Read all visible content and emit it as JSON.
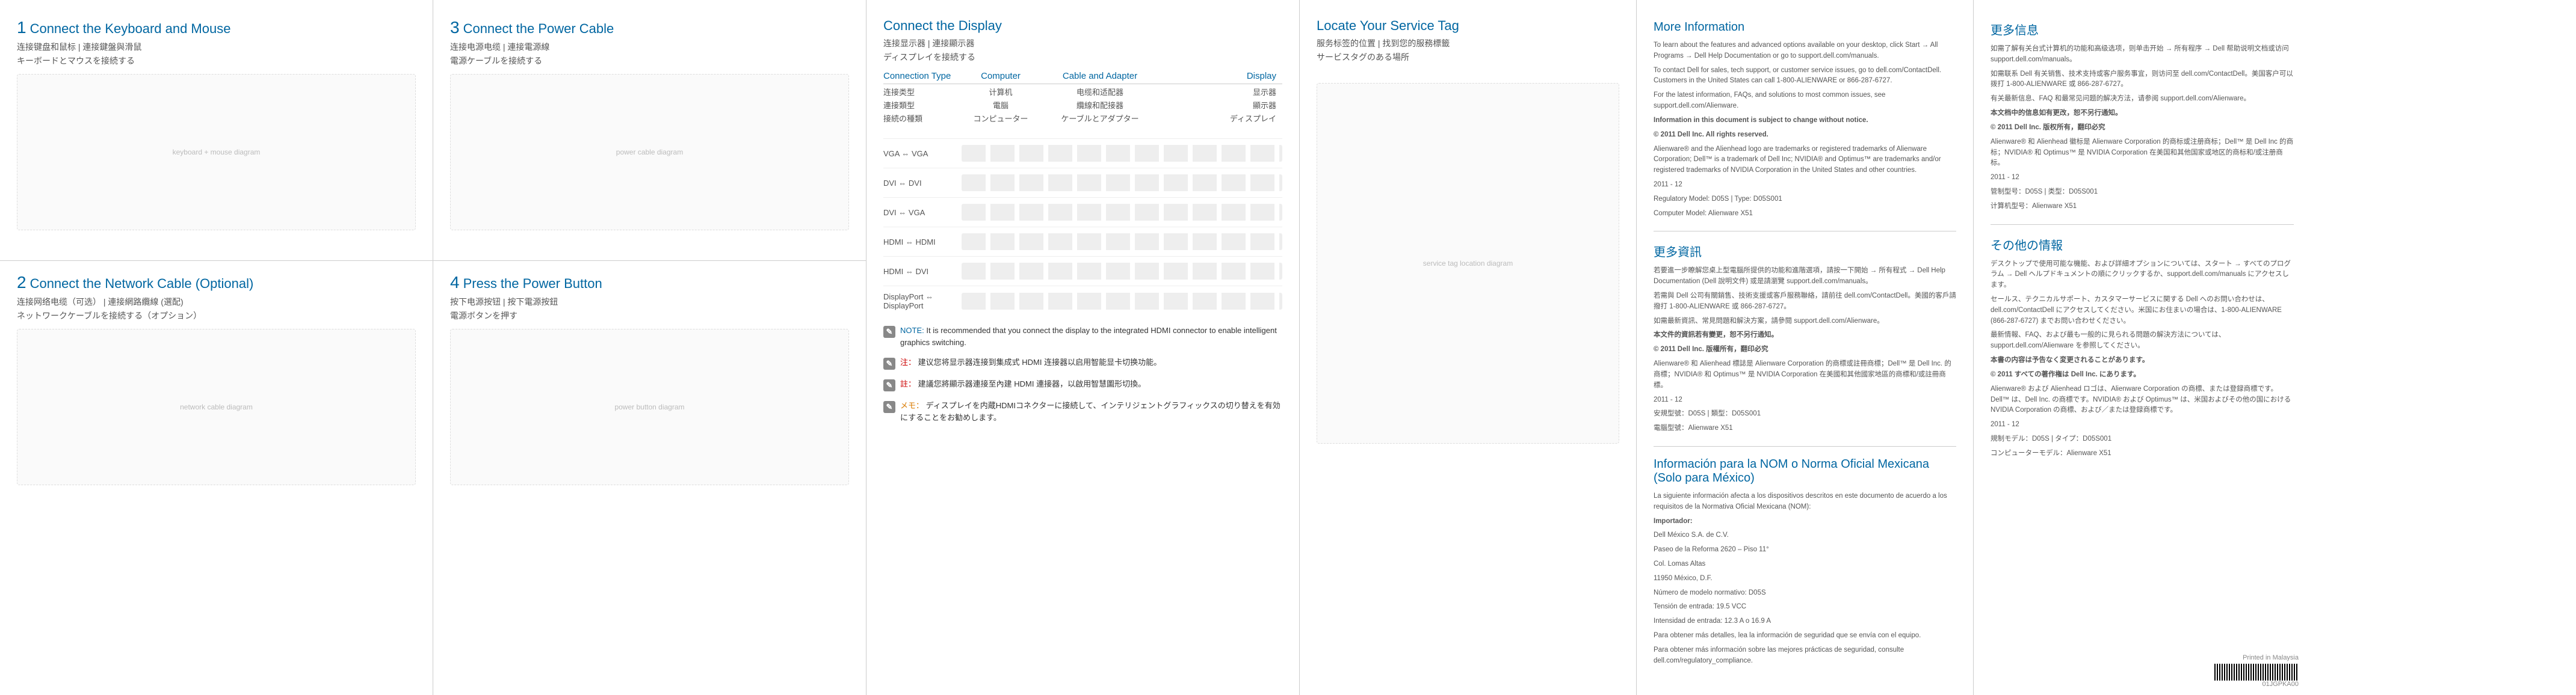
{
  "steps": {
    "s1": {
      "title": "Connect the Keyboard and Mouse",
      "zh1": "连接键盘和鼠标 | 連接鍵盤與滑鼠",
      "jp": "キーボードとマウスを接続する"
    },
    "s2": {
      "title": "Connect the Network Cable (Optional)",
      "zh1": "连接网络电缆（可选） | 連接網路纜線 (選配)",
      "jp": "ネットワークケーブルを接続する（オプション）"
    },
    "s3": {
      "title": "Connect the Power Cable",
      "zh1": "连接电源电缆 | 連接電源線",
      "jp": "電源ケーブルを接続する"
    },
    "s4": {
      "title": "Press the Power Button",
      "zh1": "按下电源按钮 | 按下電源按鈕",
      "jp": "電源ボタンを押す"
    }
  },
  "display": {
    "title": "Connect the Display",
    "zh1": "连接显示器 | 連接顯示器",
    "jp": "ディスプレイを接続する",
    "headers": {
      "en": {
        "a": "Connection Type",
        "b": "Computer",
        "c": "Cable and Adapter",
        "d": "Display"
      },
      "zh_s": {
        "a": "连接类型",
        "b": "计算机",
        "c": "电缆和适配器",
        "d": "显示器"
      },
      "zh_t": {
        "a": "連接類型",
        "b": "電腦",
        "c": "纜線和配接器",
        "d": "顯示器"
      },
      "jp": {
        "a": "接続の種類",
        "b": "コンピューター",
        "c": "ケーブルとアダプター",
        "d": "ディスプレイ"
      }
    },
    "rows": [
      "VGA ⇔ VGA",
      "DVI ⇔ DVI",
      "DVI ⇔ VGA",
      "HDMI ⇔ HDMI",
      "HDMI ⇔ DVI",
      "DisplayPort ⇔ DisplayPort"
    ],
    "notes": {
      "en": {
        "label": "NOTE:",
        "text": "It is recommended that you connect the display to the integrated HDMI connector to enable intelligent graphics switching."
      },
      "zh_s": {
        "label": "注：",
        "text": "建议您将显示器连接到集成式 HDMI 连接器以启用智能显卡切换功能。"
      },
      "zh_t": {
        "label": "註：",
        "text": "建議您將顯示器連接至內建 HDMI 連接器，以啟用智慧圖形切換。"
      },
      "jp": {
        "label": "メモ：",
        "text": "ディスプレイを内蔵HDMIコネクターに接続して、インテリジェントグラフィックスの切り替えを有効にすることをお勧めします。"
      }
    }
  },
  "service": {
    "title": "Locate Your Service Tag",
    "zh1": "服务标签的位置 | 找到您的服務標籤",
    "jp": "サービスタグのある場所"
  },
  "more_en": {
    "heading": "More Information",
    "p1": "To learn about the features and advanced options available on your desktop, click Start → All Programs → Dell Help Documentation or go to support.dell.com/manuals.",
    "p2": "To contact Dell for sales, tech support, or customer service issues, go to dell.com/ContactDell. Customers in the United States can call 1-800-ALIENWARE or 866-287-6727.",
    "p3": "For the latest information, FAQs, and solutions to most common issues, see support.dell.com/Alienware.",
    "p4": "Information in this document is subject to change without notice.",
    "p5": "© 2011 Dell Inc. All rights reserved.",
    "p6": "Alienware® and the Alienhead logo are trademarks or registered trademarks of Alienware Corporation; Dell™ is a trademark of Dell Inc; NVIDIA® and Optimus™ are trademarks and/or registered trademarks of NVIDIA Corporation in the United States and other countries.",
    "p7": "2011 - 12",
    "p8": "Regulatory Model: D05S | Type: D05S001",
    "p9": "Computer Model: Alienware X51"
  },
  "more_zhs": {
    "heading": "更多信息",
    "p1": "如需了解有关台式计算机的功能和高级选项，则单击开始 → 所有程序 → Dell 帮助说明文档或访问 support.dell.com/manuals。",
    "p2": "如需联系 Dell 有关销售、技术支持或客户服务事宜，则访问至 dell.com/ContactDell。美国客户可以拨打 1-800-ALIENWARE 或 866-287-6727。",
    "p3": "有关最新信息、FAQ 和最常见问题的解决方法，请参阅 support.dell.com/Alienware。",
    "p4": "本文档中的信息如有更改，恕不另行通知。",
    "p5": "© 2011 Dell Inc. 版权所有，翻印必究",
    "p6": "Alienware® 和 Alienhead 徽标是 Alienware Corporation 的商标或注册商标；Dell™ 是 Dell Inc 的商标；NVIDIA® 和 Optimus™ 是 NVIDIA Corporation 在美国和其他国家或地区的商标和/或注册商标。",
    "p7": "2011 - 12",
    "p8": "管制型号：D05S | 类型：D05S001",
    "p9": "计算机型号：Alienware X51"
  },
  "more_zht": {
    "heading": "更多資訊",
    "p1": "若要進一步瞭解您桌上型電腦所提供的功能和進階選項，請按一下開始 → 所有程式 → Dell Help Documentation (Dell 說明文件) 或是請瀏覽 support.dell.com/manuals。",
    "p2": "若需與 Dell 公司有關銷售、技術支援或客戶服務聯絡，請前往 dell.com/ContactDell。美國的客戶請撥打 1-800-ALIENWARE 或 866-287-6727。",
    "p3": "如需最新資訊、常見問題和解決方案，請參閱 support.dell.com/Alienware。",
    "p4": "本文件的資訊若有變更，恕不另行通知。",
    "p5": "© 2011 Dell Inc. 版權所有，翻印必究",
    "p6": "Alienware® 和 Alienhead 標誌是 Alienware Corporation 的商標或註冊商標；Dell™ 是 Dell Inc. 的商標；NVIDIA® 和 Optimus™ 是 NVIDIA Corporation 在美國和其他國家地區的商標和/或註冊商標。",
    "p7": "2011 - 12",
    "p8": "安規型號：D05S | 類型：D05S001",
    "p9": "電腦型號：Alienware X51"
  },
  "more_jp": {
    "heading": "その他の情報",
    "p1": "デスクトップで使用可能な機能、および詳細オプションについては、スタート → すべてのプログラム → Dell ヘルプドキュメントの順にクリックするか、support.dell.com/manuals にアクセスします。",
    "p2": "セールス、テクニカルサポート、カスタマーサービスに関する Dell へのお問い合わせは、dell.com/ContactDell にアクセスしてください。米国にお住まいの場合は、1-800-ALIENWARE (866-287-6727) までお問い合わせください。",
    "p3": "最新情報、FAQ、および最も一般的に見られる問題の解決方法については、support.dell.com/Alienware を参照してください。",
    "p4": "本書の内容は予告なく変更されることがあります。",
    "p5": "© 2011 すべての著作権は Dell Inc. にあります。",
    "p6": "Alienware® および Alienhead ロゴは、Alienware Corporation の商標、または登録商標です。Dell™ は、Dell Inc. の商標です。NVIDIA® および Optimus™ は、米国およびその他の国における NVIDIA Corporation の商標、および／または登録商標です。",
    "p7": "2011 - 12",
    "p8": "規制モデル：D05S | タイプ：D05S001",
    "p9": "コンピューターモデル：Alienware X51"
  },
  "nom": {
    "heading": "Información para la NOM o Norma Oficial Mexicana (Solo para México)",
    "p1": "La siguiente información afecta a los dispositivos descritos en este documento de acuerdo a los requisitos de la Normativa Oficial Mexicana (NOM):",
    "p2": "Importador:",
    "p3": "Dell México S.A. de C.V.",
    "p4": "Paseo de la Reforma 2620 – Piso 11°",
    "p5": "Col. Lomas Altas",
    "p6": "11950 México, D.F.",
    "p7": "Número de modelo normativo: D05S",
    "p8": "Tensión de entrada: 19.5 VCC",
    "p9": "Intensidad de entrada: 12.3 A o 16.9 A",
    "p10": "Para obtener más detalles, lea la información de seguridad que se envía con el equipo.",
    "p11": "Para obtener más información sobre las mejores prácticas de seguridad, consulte dell.com/regulatory_compliance."
  },
  "footer": {
    "printed": "Printed in Malaysia",
    "code": "01JGPKA00"
  }
}
